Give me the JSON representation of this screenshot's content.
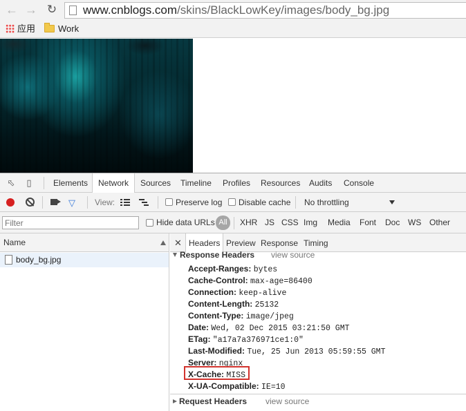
{
  "browser": {
    "back_icon": "arrow-left-icon",
    "forward_icon": "arrow-right-icon",
    "reload_icon": "reload-icon",
    "url_host": "www.cnblogs.com",
    "url_path": "/skins/BlackLowKey/images/body_bg.jpg",
    "bookmarks": [
      {
        "label": "应用",
        "icon": "apps-grid-icon"
      },
      {
        "label": "Work",
        "icon": "folder-icon"
      }
    ]
  },
  "devtools": {
    "tabs": [
      "Elements",
      "Network",
      "Sources",
      "Timeline",
      "Profiles",
      "Resources",
      "Audits",
      "Console"
    ],
    "active_tab": "Network",
    "toolbar": {
      "view_label": "View:",
      "preserve_log": "Preserve log",
      "disable_cache": "Disable cache",
      "throttling": "No throttling"
    },
    "filter": {
      "placeholder": "Filter",
      "hide_data_urls": "Hide data URLs",
      "all_label": "All",
      "types": [
        "XHR",
        "JS",
        "CSS",
        "Img",
        "Media",
        "Font",
        "Doc",
        "WS",
        "Other"
      ]
    },
    "name_column": "Name",
    "requests": [
      "body_bg.jpg"
    ],
    "detail_tabs": [
      "Headers",
      "Preview",
      "Response",
      "Timing"
    ],
    "response_headers_title": "Response Headers",
    "view_source": "view source",
    "response_headers": [
      {
        "key": "Accept-Ranges:",
        "value": "bytes"
      },
      {
        "key": "Cache-Control:",
        "value": "max-age=86400"
      },
      {
        "key": "Connection:",
        "value": "keep-alive"
      },
      {
        "key": "Content-Length:",
        "value": "25132"
      },
      {
        "key": "Content-Type:",
        "value": "image/jpeg"
      },
      {
        "key": "Date:",
        "value": "Wed, 02 Dec 2015 03:21:50 GMT"
      },
      {
        "key": "ETag:",
        "value": "\"a17a7a376971ce1:0\""
      },
      {
        "key": "Last-Modified:",
        "value": "Tue, 25 Jun 2013 05:59:55 GMT"
      },
      {
        "key": "Server:",
        "value": "nginx"
      },
      {
        "key": "X-Cache:",
        "value": "MISS"
      },
      {
        "key": "X-UA-Compatible:",
        "value": "IE=10"
      }
    ],
    "request_headers_title": "Request Headers",
    "highlight_color": "#d2322d"
  }
}
